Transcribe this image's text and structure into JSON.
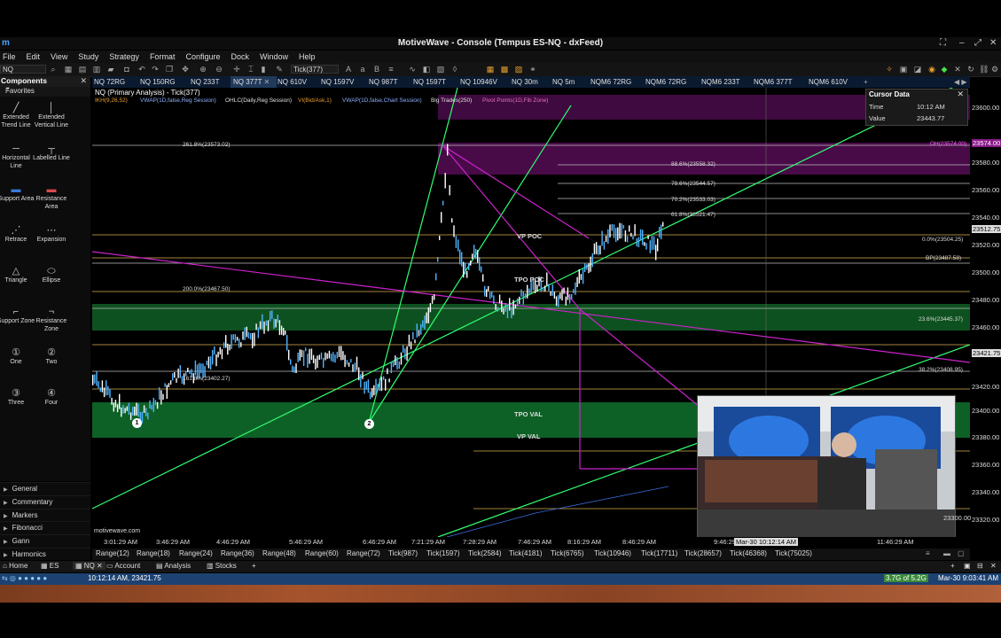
{
  "window": {
    "title": "MotiveWave - Console (Tempus ES-NQ - dxFeed)"
  },
  "menu": [
    "File",
    "Edit",
    "View",
    "Study",
    "Strategy",
    "Format",
    "Configure",
    "Dock",
    "Window",
    "Help"
  ],
  "toolbar": {
    "symbol": "NQ",
    "bar_size": "Tick(377)"
  },
  "tabs": [
    "NQ 72RG",
    "NQ 150RG",
    "NQ 233T",
    "NQ 377T",
    "NQ 610V",
    "NQ 1597V",
    "NQ 987T",
    "NQ 1597T",
    "NQ 10946V",
    "NQ 30m",
    "NQ 5m",
    "NQM6 72RG",
    "NQM6 72RG",
    "NQM6 233T",
    "NQM6 377T",
    "NQM6 610V"
  ],
  "components": {
    "header": "Components",
    "favorites": "Favorites",
    "tools": [
      {
        "label": "Extended Trend Line",
        "icon": "trend-line-icon"
      },
      {
        "label": "Extended Vertical Line",
        "icon": "vertical-line-icon"
      },
      {
        "label": "Horizontal Line",
        "icon": "horizontal-line-icon"
      },
      {
        "label": "Labelled Line",
        "icon": "labelled-line-icon"
      },
      {
        "label": "Support Area",
        "icon": "support-area-icon"
      },
      {
        "label": "Resistance Area",
        "icon": "resistance-area-icon"
      },
      {
        "label": "Retrace",
        "icon": "retrace-icon"
      },
      {
        "label": "Expansion",
        "icon": "expansion-icon"
      },
      {
        "label": "Triangle",
        "icon": "triangle-icon"
      },
      {
        "label": "Ellipse",
        "icon": "ellipse-icon"
      },
      {
        "label": "Support Zone",
        "icon": "support-zone-icon"
      },
      {
        "label": "Resistance Zone",
        "icon": "resistance-zone-icon"
      },
      {
        "label": "One",
        "icon": "one-icon"
      },
      {
        "label": "Two",
        "icon": "two-icon"
      },
      {
        "label": "Three",
        "icon": "three-icon"
      },
      {
        "label": "Four",
        "icon": "four-icon"
      }
    ],
    "categories": [
      "General",
      "Commentary",
      "Markers",
      "Fibonacci",
      "Gann",
      "Harmonics"
    ]
  },
  "chart": {
    "title": "NQ (Primary Analysis) - Tick(377)",
    "studies": [
      {
        "text": "IKH(9,26,52)",
        "color": "#e8a030"
      },
      {
        "text": "VWAP(1D,false,Reg Session)",
        "color": "#8fb0ff"
      },
      {
        "text": "OHLC(Daily,Reg Session)",
        "color": "#e0e0e0"
      },
      {
        "text": "VI(Bid/Ask,1)",
        "color": "#e8a030"
      },
      {
        "text": "VWAP(1D,false,Chart Session)",
        "color": "#8fb0ff"
      },
      {
        "text": "Big Trades(250)",
        "color": "#e0e0e0"
      },
      {
        "text": "Pivot Points(1D,Fib Zone)",
        "color": "#e070c0"
      }
    ],
    "labels": {
      "fib_261": "261.8%(23573.02)",
      "fib_200": "200.0%(23467.50)",
      "fib_161": "161.8%(23402.27)",
      "fib_886": "88.6%(23558.32)",
      "fib_786": "78.6%(23544.57)",
      "fib_702": "70.2%(23533.03)",
      "fib_618": "61.8%(23521.47)",
      "fib_0": "0.0%(23504.25)",
      "bp": "BP(23487.58)",
      "fib_236": "23.6%(23445.37)",
      "fib_382": "38.2%(23408.95)",
      "oh": "OH(23574.00)",
      "vp_poc": "VP POC",
      "tpo_poc": "TPO POC",
      "tpo_val": "TPO VAL",
      "vp_val": "VP VAL",
      "marker1": "1",
      "marker2": "2",
      "watermark": "motivewave.com"
    },
    "time_labels": [
      "3:01:29 AM",
      "3:46:29 AM",
      "4:46:29 AM",
      "5:46:29 AM",
      "6:46:29 AM",
      "7:21:29 AM",
      "7:28:29 AM",
      "7:46:29 AM",
      "8:16:29 AM",
      "8:46:29 AM",
      "9:46:29 AM",
      "11:46:29 AM"
    ],
    "cursor_time_label": "Mar-30 10:12:14 AM"
  },
  "price_axis": {
    "ticks": [
      "23600.00",
      "23580.00",
      "23560.00",
      "23540.00",
      "23520.00",
      "23500.00",
      "23480.00",
      "23460.00",
      "23440.00",
      "23420.00",
      "23400.00",
      "23380.00",
      "23360.00",
      "23340.00",
      "23320.00",
      "23300.00"
    ],
    "markers": [
      "23574.00",
      "23512.75",
      "23421.75"
    ]
  },
  "cursor_data": {
    "title": "Cursor Data",
    "time_label": "Time",
    "time_value": "10:12 AM",
    "value_label": "Value",
    "value": "23443.77"
  },
  "bar_types": [
    "Range(12)",
    "Range(18)",
    "Range(24)",
    "Range(36)",
    "Range(48)",
    "Range(60)",
    "Range(72)",
    "Tick(987)",
    "Tick(1597)",
    "Tick(2584)",
    "Tick(4181)",
    "Tick(6765)",
    "Tick(10946)",
    "Tick(17711)",
    "Tick(28657)",
    "Tick(46368)",
    "Tick(75025)"
  ],
  "bottom_tabs": [
    "Home",
    "ES",
    "NQ",
    "Account",
    "Analysis",
    "Stocks"
  ],
  "status": {
    "left": "10:12:14 AM, 23421.75",
    "memory": "3.7G of 5.2G",
    "right": "Mar-30 9:03:41 AM"
  },
  "colors": {
    "fib_magenta": "#cc22cc",
    "trend_green": "#30ff70",
    "zone_green": "#0f6b2a",
    "zone_purple": "#5a0e5a",
    "status_blue": "#1d4272"
  }
}
